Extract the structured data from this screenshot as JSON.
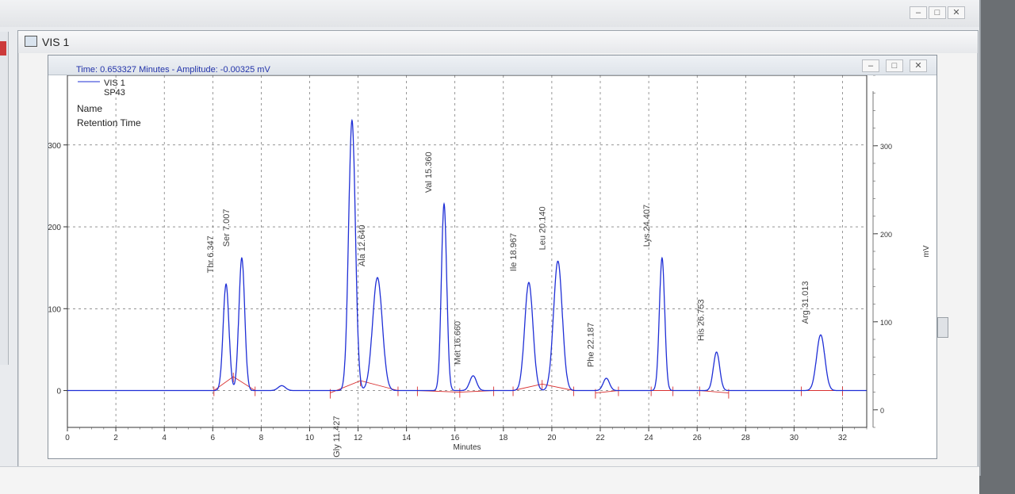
{
  "window": {
    "title": "VIS 1",
    "controls": [
      "minimize",
      "maximize",
      "close"
    ]
  },
  "readout": {
    "text": "Time:  0.653327 Minutes - Amplitude:  -0.00325 mV"
  },
  "legend": {
    "trace_name": "VIS 1",
    "sample_name": "SP43",
    "label_fields": [
      "Name",
      "Retention Time"
    ]
  },
  "colors": {
    "trace": "#1f2fd6",
    "baseline": "#d93030",
    "grid": "#555555",
    "readout": "#2233aa"
  },
  "chart_data": {
    "type": "line",
    "xlabel": "Minutes",
    "ylabel": "mV",
    "y2label": "mV",
    "xlim": [
      0,
      33
    ],
    "ylim": [
      -45,
      385
    ],
    "y2lim": [
      -20,
      380
    ],
    "x_ticks": [
      0,
      2,
      4,
      6,
      8,
      10,
      12,
      14,
      16,
      18,
      20,
      22,
      24,
      26,
      28,
      30,
      32
    ],
    "y_ticks": [
      0,
      100,
      200,
      300
    ],
    "y2_ticks": [
      0,
      100,
      200,
      300
    ],
    "grid": true,
    "legend_position": "top-left",
    "series": [
      {
        "name": "VIS 1",
        "peaks": [
          {
            "label": "Thr 6.347",
            "x": 6.55,
            "height": 130,
            "width": 0.12
          },
          {
            "label": "Ser 7.007",
            "x": 7.2,
            "height": 162,
            "width": 0.12
          },
          {
            "label": "",
            "x": 8.85,
            "height": 6,
            "width": 0.15
          },
          {
            "label": "Gly 11.427",
            "x": 11.75,
            "height": 330,
            "width": 0.14
          },
          {
            "label": "Ala 12.640",
            "x": 12.8,
            "height": 138,
            "width": 0.2
          },
          {
            "label": "Val 15.360",
            "x": 15.55,
            "height": 228,
            "width": 0.11
          },
          {
            "label": "Met 16.660",
            "x": 16.75,
            "height": 18,
            "width": 0.14
          },
          {
            "label": "Ile 18.967",
            "x": 19.05,
            "height": 132,
            "width": 0.17
          },
          {
            "label": "Leu 20.140",
            "x": 20.25,
            "height": 158,
            "width": 0.18
          },
          {
            "label": "Phe 22.187",
            "x": 22.25,
            "height": 15,
            "width": 0.13
          },
          {
            "label": "Lys 24.407",
            "x": 24.55,
            "height": 162,
            "width": 0.11
          },
          {
            "label": "His 26.753",
            "x": 26.8,
            "height": 47,
            "width": 0.13
          },
          {
            "label": "Arg 31.013",
            "x": 31.1,
            "height": 68,
            "width": 0.17
          }
        ]
      }
    ],
    "baseline_segments": [
      [
        [
          6.05,
          0
        ],
        [
          6.85,
          17
        ],
        [
          7.75,
          0
        ]
      ],
      [
        [
          10.85,
          -3
        ],
        [
          12.1,
          12
        ],
        [
          13.65,
          0
        ]
      ],
      [
        [
          14.45,
          0
        ],
        [
          16.2,
          -2
        ],
        [
          17.6,
          0
        ]
      ],
      [
        [
          18.4,
          0
        ],
        [
          19.6,
          8
        ],
        [
          20.9,
          0
        ]
      ],
      [
        [
          21.8,
          -3
        ],
        [
          22.75,
          0
        ]
      ],
      [
        [
          24.1,
          0
        ],
        [
          25.0,
          0
        ]
      ],
      [
        [
          26.1,
          0
        ],
        [
          27.3,
          -3
        ]
      ],
      [
        [
          30.3,
          0
        ],
        [
          32.0,
          0
        ]
      ]
    ]
  }
}
